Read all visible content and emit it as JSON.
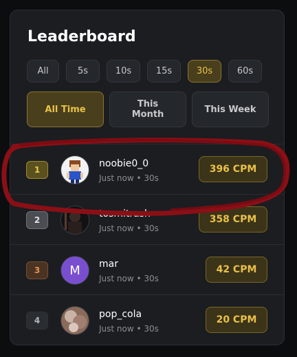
{
  "leaderboard": {
    "title": "Leaderboard",
    "durations": [
      "All",
      "5s",
      "10s",
      "15s",
      "30s",
      "60s"
    ],
    "active_duration": "30s",
    "periods": [
      "All Time",
      "This\nMonth",
      "This Week"
    ],
    "active_period": "All Time",
    "entries": [
      {
        "rank": "1",
        "name": "noobie0_0",
        "time": "Just now • 30s",
        "cpm": "396 CPM"
      },
      {
        "rank": "2",
        "name": "tosmitrash",
        "time": "Just now • 30s",
        "cpm": "358 CPM"
      },
      {
        "rank": "3",
        "name": "mar",
        "avatar_letter": "M",
        "time": "Just now • 30s",
        "cpm": "42 CPM"
      },
      {
        "rank": "4",
        "name": "pop_cola",
        "time": "Just now • 30s",
        "cpm": "20 CPM"
      }
    ]
  },
  "colors": {
    "accent": "#e7c24a",
    "annotation": "#8b0f16",
    "avatar_letter_bg": "#7a4fcf"
  }
}
